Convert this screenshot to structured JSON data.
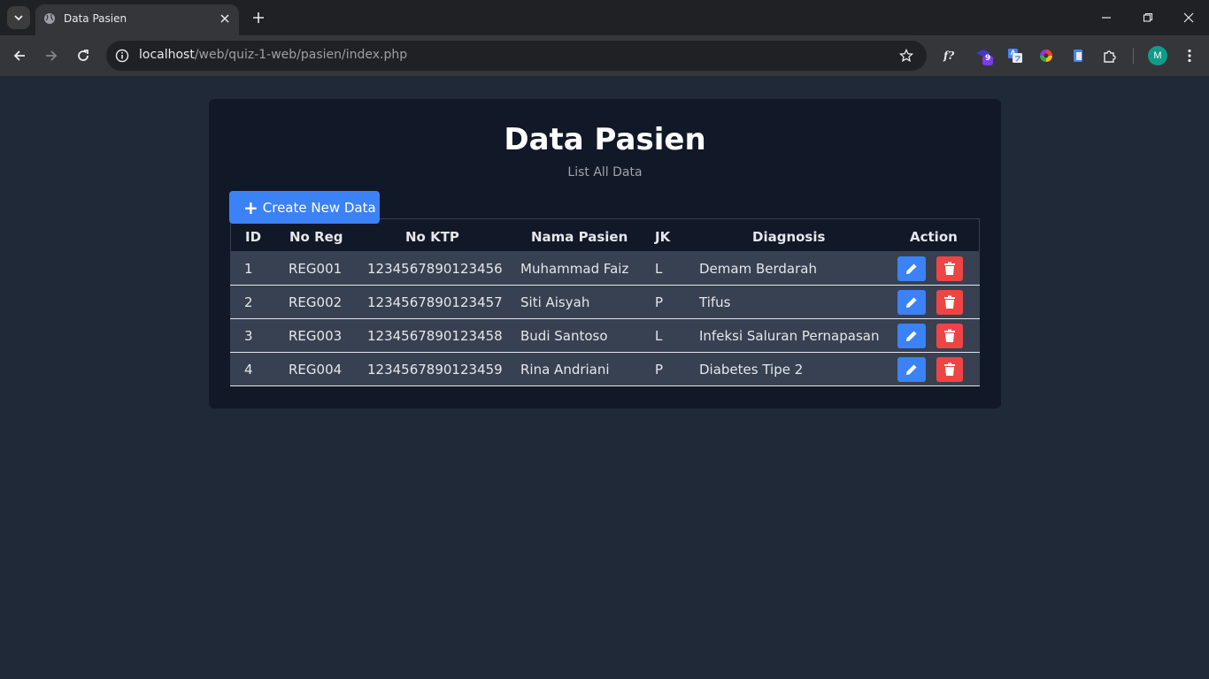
{
  "browser": {
    "tab_title": "Data Pasien",
    "url_host": "localhost",
    "url_path": "/web/quiz-1-web/pasien/index.php",
    "extension_badge": "9",
    "avatar_initial": "M",
    "accent_color": "#3b82f6"
  },
  "page": {
    "title": "Data Pasien",
    "subtitle": "List All Data",
    "create_button": "Create New Data"
  },
  "table": {
    "headers": [
      "ID",
      "No Reg",
      "No KTP",
      "Nama Pasien",
      "JK",
      "Diagnosis",
      "Action"
    ],
    "rows": [
      {
        "id": "1",
        "no_reg": "REG001",
        "no_ktp": "1234567890123456",
        "nama": "Muhammad Faiz",
        "jk": "L",
        "diagnosis": "Demam Berdarah"
      },
      {
        "id": "2",
        "no_reg": "REG002",
        "no_ktp": "1234567890123457",
        "nama": "Siti Aisyah",
        "jk": "P",
        "diagnosis": "Tifus"
      },
      {
        "id": "3",
        "no_reg": "REG003",
        "no_ktp": "1234567890123458",
        "nama": "Budi Santoso",
        "jk": "L",
        "diagnosis": "Infeksi Saluran Pernapasan"
      },
      {
        "id": "4",
        "no_reg": "REG004",
        "no_ktp": "1234567890123459",
        "nama": "Rina Andriani",
        "jk": "P",
        "diagnosis": "Diabetes Tipe 2"
      }
    ]
  },
  "colors": {
    "edit_button": "#3b82f6",
    "delete_button": "#ef4444"
  }
}
